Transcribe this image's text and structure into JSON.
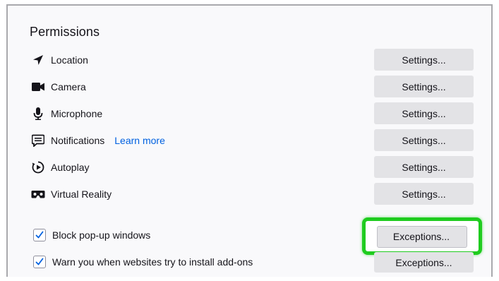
{
  "section": {
    "title": "Permissions"
  },
  "permissions": [
    {
      "label": "Location",
      "icon": "location-arrow-icon",
      "button": "Settings..."
    },
    {
      "label": "Camera",
      "icon": "camera-icon",
      "button": "Settings..."
    },
    {
      "label": "Microphone",
      "icon": "microphone-icon",
      "button": "Settings..."
    },
    {
      "label": "Notifications",
      "icon": "notifications-icon",
      "button": "Settings...",
      "link": "Learn more"
    },
    {
      "label": "Autoplay",
      "icon": "autoplay-icon",
      "button": "Settings..."
    },
    {
      "label": "Virtual Reality",
      "icon": "vr-headset-icon",
      "button": "Settings..."
    }
  ],
  "checks": [
    {
      "label": "Block pop-up windows",
      "checked": true,
      "button": "Exceptions..."
    },
    {
      "label": "Warn you when websites try to install add-ons",
      "checked": true,
      "button": "Exceptions..."
    }
  ],
  "colors": {
    "accent": "#0061e0",
    "highlight": "#1fcc1f",
    "button_bg": "#e3e3e6",
    "panel_bg": "#f9f9fb"
  }
}
